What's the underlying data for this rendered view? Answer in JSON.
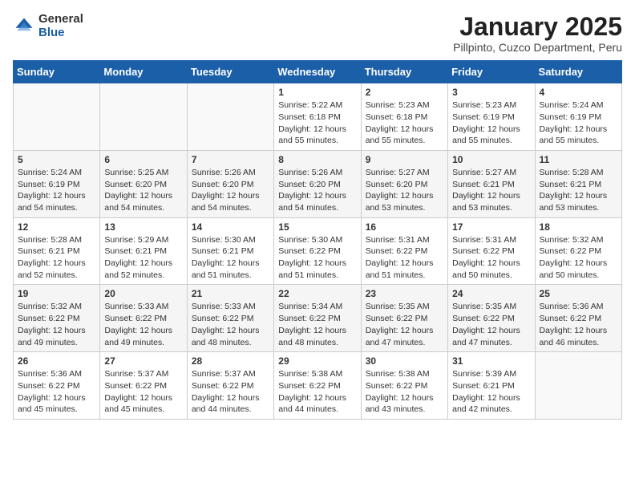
{
  "logo": {
    "general": "General",
    "blue": "Blue"
  },
  "title": "January 2025",
  "location": "Pillpinto, Cuzco Department, Peru",
  "weekdays": [
    "Sunday",
    "Monday",
    "Tuesday",
    "Wednesday",
    "Thursday",
    "Friday",
    "Saturday"
  ],
  "weeks": [
    [
      {
        "day": "",
        "info": ""
      },
      {
        "day": "",
        "info": ""
      },
      {
        "day": "",
        "info": ""
      },
      {
        "day": "1",
        "info": "Sunrise: 5:22 AM\nSunset: 6:18 PM\nDaylight: 12 hours and 55 minutes."
      },
      {
        "day": "2",
        "info": "Sunrise: 5:23 AM\nSunset: 6:18 PM\nDaylight: 12 hours and 55 minutes."
      },
      {
        "day": "3",
        "info": "Sunrise: 5:23 AM\nSunset: 6:19 PM\nDaylight: 12 hours and 55 minutes."
      },
      {
        "day": "4",
        "info": "Sunrise: 5:24 AM\nSunset: 6:19 PM\nDaylight: 12 hours and 55 minutes."
      }
    ],
    [
      {
        "day": "5",
        "info": "Sunrise: 5:24 AM\nSunset: 6:19 PM\nDaylight: 12 hours and 54 minutes."
      },
      {
        "day": "6",
        "info": "Sunrise: 5:25 AM\nSunset: 6:20 PM\nDaylight: 12 hours and 54 minutes."
      },
      {
        "day": "7",
        "info": "Sunrise: 5:26 AM\nSunset: 6:20 PM\nDaylight: 12 hours and 54 minutes."
      },
      {
        "day": "8",
        "info": "Sunrise: 5:26 AM\nSunset: 6:20 PM\nDaylight: 12 hours and 54 minutes."
      },
      {
        "day": "9",
        "info": "Sunrise: 5:27 AM\nSunset: 6:20 PM\nDaylight: 12 hours and 53 minutes."
      },
      {
        "day": "10",
        "info": "Sunrise: 5:27 AM\nSunset: 6:21 PM\nDaylight: 12 hours and 53 minutes."
      },
      {
        "day": "11",
        "info": "Sunrise: 5:28 AM\nSunset: 6:21 PM\nDaylight: 12 hours and 53 minutes."
      }
    ],
    [
      {
        "day": "12",
        "info": "Sunrise: 5:28 AM\nSunset: 6:21 PM\nDaylight: 12 hours and 52 minutes."
      },
      {
        "day": "13",
        "info": "Sunrise: 5:29 AM\nSunset: 6:21 PM\nDaylight: 12 hours and 52 minutes."
      },
      {
        "day": "14",
        "info": "Sunrise: 5:30 AM\nSunset: 6:21 PM\nDaylight: 12 hours and 51 minutes."
      },
      {
        "day": "15",
        "info": "Sunrise: 5:30 AM\nSunset: 6:22 PM\nDaylight: 12 hours and 51 minutes."
      },
      {
        "day": "16",
        "info": "Sunrise: 5:31 AM\nSunset: 6:22 PM\nDaylight: 12 hours and 51 minutes."
      },
      {
        "day": "17",
        "info": "Sunrise: 5:31 AM\nSunset: 6:22 PM\nDaylight: 12 hours and 50 minutes."
      },
      {
        "day": "18",
        "info": "Sunrise: 5:32 AM\nSunset: 6:22 PM\nDaylight: 12 hours and 50 minutes."
      }
    ],
    [
      {
        "day": "19",
        "info": "Sunrise: 5:32 AM\nSunset: 6:22 PM\nDaylight: 12 hours and 49 minutes."
      },
      {
        "day": "20",
        "info": "Sunrise: 5:33 AM\nSunset: 6:22 PM\nDaylight: 12 hours and 49 minutes."
      },
      {
        "day": "21",
        "info": "Sunrise: 5:33 AM\nSunset: 6:22 PM\nDaylight: 12 hours and 48 minutes."
      },
      {
        "day": "22",
        "info": "Sunrise: 5:34 AM\nSunset: 6:22 PM\nDaylight: 12 hours and 48 minutes."
      },
      {
        "day": "23",
        "info": "Sunrise: 5:35 AM\nSunset: 6:22 PM\nDaylight: 12 hours and 47 minutes."
      },
      {
        "day": "24",
        "info": "Sunrise: 5:35 AM\nSunset: 6:22 PM\nDaylight: 12 hours and 47 minutes."
      },
      {
        "day": "25",
        "info": "Sunrise: 5:36 AM\nSunset: 6:22 PM\nDaylight: 12 hours and 46 minutes."
      }
    ],
    [
      {
        "day": "26",
        "info": "Sunrise: 5:36 AM\nSunset: 6:22 PM\nDaylight: 12 hours and 45 minutes."
      },
      {
        "day": "27",
        "info": "Sunrise: 5:37 AM\nSunset: 6:22 PM\nDaylight: 12 hours and 45 minutes."
      },
      {
        "day": "28",
        "info": "Sunrise: 5:37 AM\nSunset: 6:22 PM\nDaylight: 12 hours and 44 minutes."
      },
      {
        "day": "29",
        "info": "Sunrise: 5:38 AM\nSunset: 6:22 PM\nDaylight: 12 hours and 44 minutes."
      },
      {
        "day": "30",
        "info": "Sunrise: 5:38 AM\nSunset: 6:22 PM\nDaylight: 12 hours and 43 minutes."
      },
      {
        "day": "31",
        "info": "Sunrise: 5:39 AM\nSunset: 6:21 PM\nDaylight: 12 hours and 42 minutes."
      },
      {
        "day": "",
        "info": ""
      }
    ]
  ]
}
